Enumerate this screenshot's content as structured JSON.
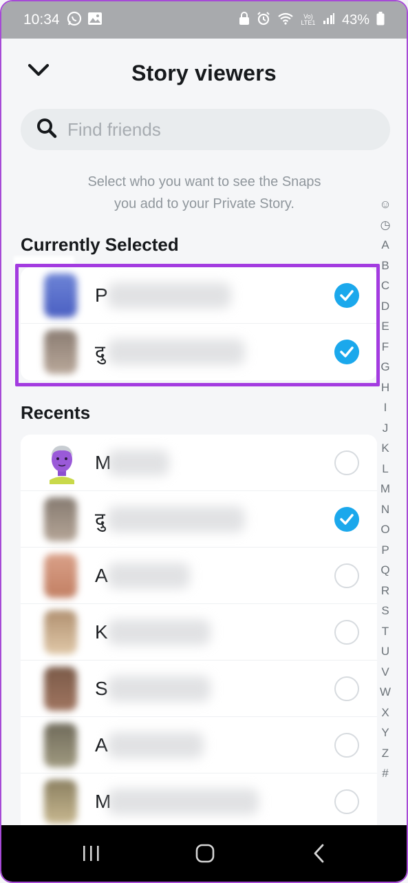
{
  "status_bar": {
    "time": "10:34",
    "battery": "43%",
    "network": "Vo) LTE1"
  },
  "header": {
    "title": "Story viewers",
    "back_icon": "chevron-down-icon"
  },
  "search": {
    "placeholder": "Find friends",
    "value": ""
  },
  "helper_text": {
    "line1": "Select who you want to see the Snaps",
    "line2": "you add to your Private Story."
  },
  "currently_selected": {
    "title": "Currently Selected",
    "items": [
      {
        "initial": "P",
        "selected": true
      },
      {
        "initial": "दु",
        "selected": true
      }
    ]
  },
  "recents": {
    "title": "Recents",
    "items": [
      {
        "initial": "M",
        "selected": false
      },
      {
        "initial": "दु",
        "selected": true
      },
      {
        "initial": "A",
        "selected": false
      },
      {
        "initial": "K",
        "selected": false
      },
      {
        "initial": "S",
        "selected": false
      },
      {
        "initial": "A",
        "selected": false
      },
      {
        "initial": "M",
        "selected": false
      }
    ]
  },
  "alphabet_index": [
    "☺",
    "◷",
    "A",
    "B",
    "C",
    "D",
    "E",
    "F",
    "G",
    "H",
    "I",
    "J",
    "K",
    "L",
    "M",
    "N",
    "O",
    "P",
    "Q",
    "R",
    "S",
    "T",
    "U",
    "V",
    "W",
    "X",
    "Y",
    "Z",
    "#"
  ],
  "colors": {
    "accent": "#1ba8ec",
    "highlight": "#a33be0"
  }
}
